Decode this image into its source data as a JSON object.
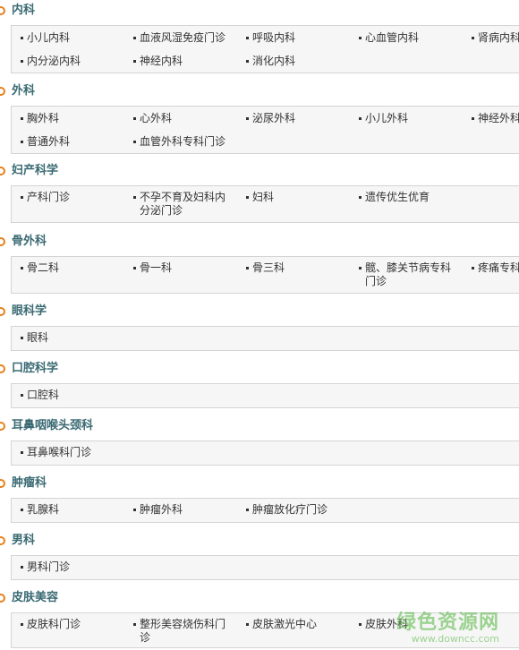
{
  "sections": [
    {
      "title": "内科",
      "items": [
        "小儿内科",
        "血液风湿免疫门诊",
        "呼吸内科",
        "心血管内科",
        "肾病内科",
        "内分泌内科",
        "神经内科",
        "消化内科"
      ]
    },
    {
      "title": "外科",
      "items": [
        "胸外科",
        "心外科",
        "泌尿外科",
        "小儿外科",
        "神经外科",
        "普通外科",
        "血管外科专科门诊"
      ]
    },
    {
      "title": "妇产科学",
      "items": [
        "产科门诊",
        "不孕不育及妇科内分泌门诊",
        "妇科",
        "遗传优生优育"
      ]
    },
    {
      "title": "骨外科",
      "items": [
        "骨二科",
        "骨一科",
        "骨三科",
        "髋、膝关节病专科门诊",
        "疼痛专科"
      ]
    },
    {
      "title": "眼科学",
      "items": [
        "眼科"
      ]
    },
    {
      "title": "口腔科学",
      "items": [
        "口腔科"
      ]
    },
    {
      "title": "耳鼻咽喉头颈科",
      "items": [
        "耳鼻喉科门诊"
      ]
    },
    {
      "title": "肿瘤科",
      "items": [
        "乳腺科",
        "肿瘤外科",
        "肿瘤放化疗门诊"
      ]
    },
    {
      "title": "男科",
      "items": [
        "男科门诊"
      ]
    },
    {
      "title": "皮肤美容",
      "items": [
        "皮肤科门诊",
        "整形美容烧伤科门诊",
        "皮肤激光中心",
        "皮肤外科"
      ]
    }
  ],
  "watermark": {
    "name": "绿色资源网",
    "url": "www.downcc.com"
  }
}
